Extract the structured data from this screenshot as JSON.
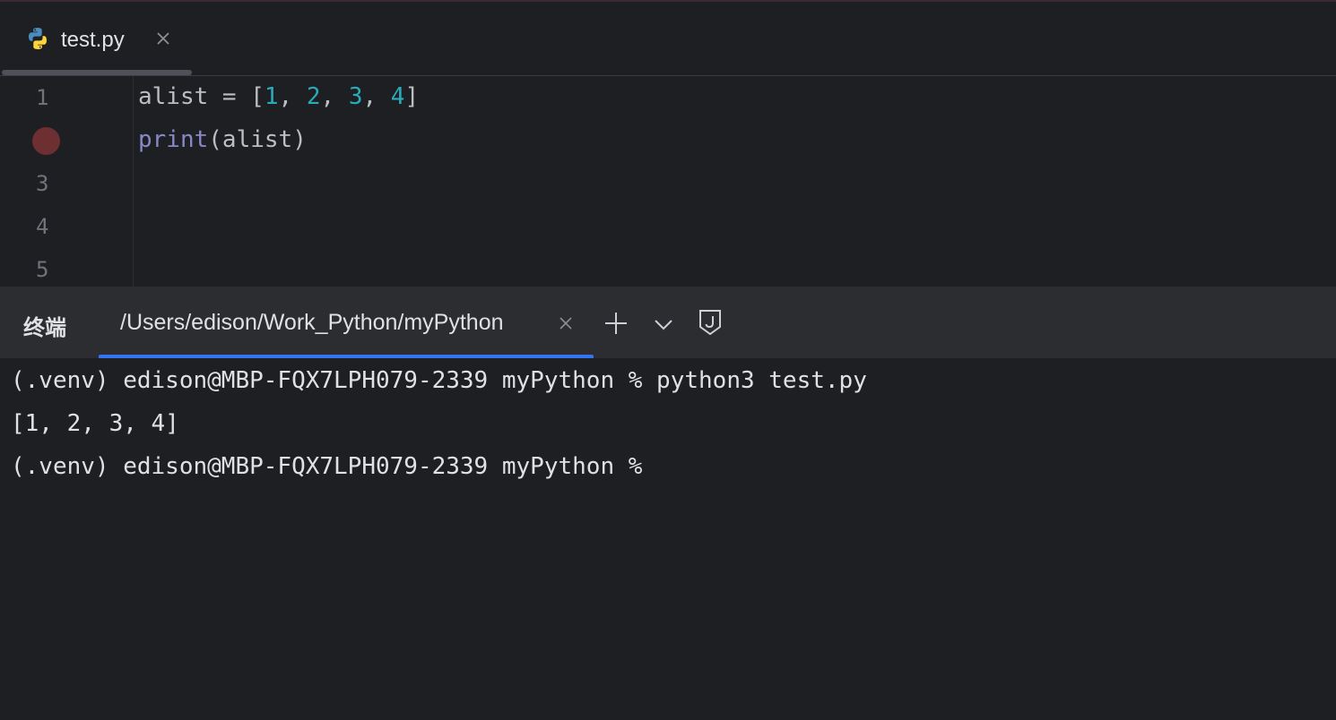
{
  "editor_tab": {
    "filename": "test.py",
    "icon": "python-file-icon",
    "close_icon": "close-icon"
  },
  "editor": {
    "line_numbers": [
      "1",
      "3",
      "4",
      "5"
    ],
    "breakpoint_line": 2,
    "code": {
      "line1": {
        "prefix": "alist = [",
        "n1": "1",
        "sep1": ", ",
        "n2": "2",
        "sep2": ", ",
        "n3": "3",
        "sep3": ", ",
        "n4": "4",
        "suffix": "]"
      },
      "line2": {
        "builtin": "print",
        "rest": "(alist)"
      }
    }
  },
  "terminal": {
    "title": "终端",
    "tab_label": "/Users/edison/Work_Python/myPython",
    "tab_close_icon": "close-icon",
    "add_icon": "plus-icon",
    "dropdown_icon": "chevron-down-icon",
    "j_icon": "jump-icon",
    "lines": [
      "(.venv) edison@MBP-FQX7LPH079-2339 myPython % python3 test.py",
      "[1, 2, 3, 4]",
      "(.venv) edison@MBP-FQX7LPH079-2339 myPython %"
    ]
  },
  "colors": {
    "background": "#1e1f22",
    "panel_header": "#2b2d30",
    "accent": "#3574f0",
    "number": "#2aacb8",
    "builtin": "#8888c6",
    "breakpoint": "#6e2f33"
  }
}
